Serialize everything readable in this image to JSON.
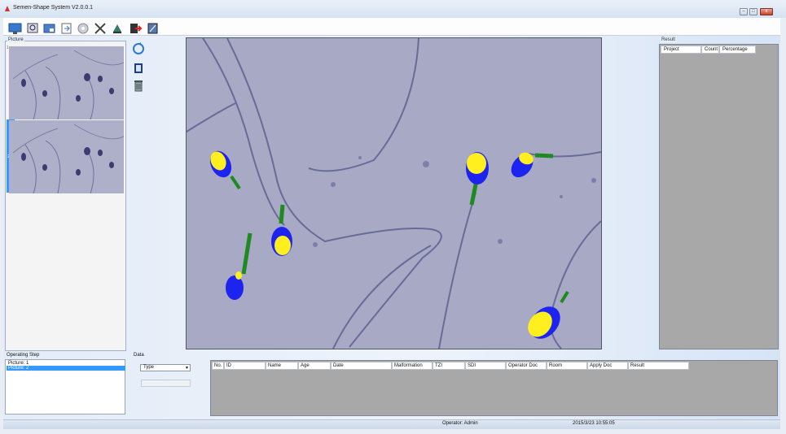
{
  "window": {
    "title": "Semen-Shape System V2.0.0.1"
  },
  "toolbar": {
    "icons": [
      "monitor-icon",
      "view-icon",
      "image-icon",
      "export-icon",
      "settings-icon",
      "tools-icon",
      "upload-icon",
      "exit-icon",
      "help-icon"
    ]
  },
  "picture": {
    "label": "Picture",
    "thumbs": [
      {
        "index": "1"
      },
      {
        "index": "2",
        "selected": true
      }
    ]
  },
  "side_tools": {
    "icons": [
      "refresh-icon",
      "film-icon",
      "delete-icon"
    ]
  },
  "result": {
    "label": "Result",
    "columns": [
      "Project",
      "Count",
      "Percentage"
    ]
  },
  "operating_step": {
    "label": "Operating Step",
    "items": [
      "Picture: 1",
      "Picture: 2"
    ],
    "selected_index": 1
  },
  "data": {
    "label": "Data",
    "type_select": "Type",
    "columns": [
      "No.",
      "ID",
      "Name",
      "Age",
      "Date",
      "Malformation",
      "TZI",
      "SDI",
      "Operator Doc",
      "Room",
      "Apply Doc",
      "Result"
    ]
  },
  "status": {
    "operator": "Operator: Admin",
    "datetime": "2015/3/23 10:55:05"
  },
  "colors": {
    "head_yellow": "#ffef1e",
    "head_blue": "#1e24f0",
    "tail_green": "#1f8a1f",
    "background": "#a7a9c5"
  }
}
